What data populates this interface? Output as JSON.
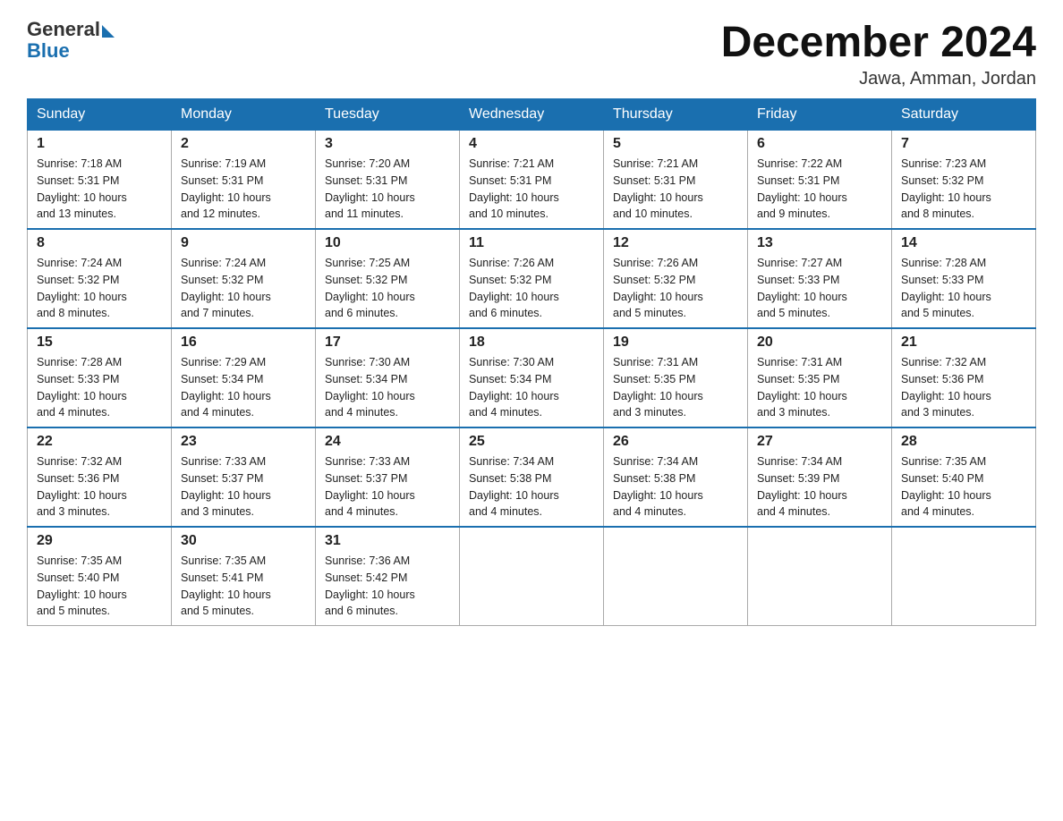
{
  "logo": {
    "general": "General",
    "blue": "Blue"
  },
  "title": "December 2024",
  "location": "Jawa, Amman, Jordan",
  "days_header": [
    "Sunday",
    "Monday",
    "Tuesday",
    "Wednesday",
    "Thursday",
    "Friday",
    "Saturday"
  ],
  "weeks": [
    [
      {
        "day": "1",
        "sunrise": "7:18 AM",
        "sunset": "5:31 PM",
        "daylight": "10 hours and 13 minutes."
      },
      {
        "day": "2",
        "sunrise": "7:19 AM",
        "sunset": "5:31 PM",
        "daylight": "10 hours and 12 minutes."
      },
      {
        "day": "3",
        "sunrise": "7:20 AM",
        "sunset": "5:31 PM",
        "daylight": "10 hours and 11 minutes."
      },
      {
        "day": "4",
        "sunrise": "7:21 AM",
        "sunset": "5:31 PM",
        "daylight": "10 hours and 10 minutes."
      },
      {
        "day": "5",
        "sunrise": "7:21 AM",
        "sunset": "5:31 PM",
        "daylight": "10 hours and 10 minutes."
      },
      {
        "day": "6",
        "sunrise": "7:22 AM",
        "sunset": "5:31 PM",
        "daylight": "10 hours and 9 minutes."
      },
      {
        "day": "7",
        "sunrise": "7:23 AM",
        "sunset": "5:32 PM",
        "daylight": "10 hours and 8 minutes."
      }
    ],
    [
      {
        "day": "8",
        "sunrise": "7:24 AM",
        "sunset": "5:32 PM",
        "daylight": "10 hours and 8 minutes."
      },
      {
        "day": "9",
        "sunrise": "7:24 AM",
        "sunset": "5:32 PM",
        "daylight": "10 hours and 7 minutes."
      },
      {
        "day": "10",
        "sunrise": "7:25 AM",
        "sunset": "5:32 PM",
        "daylight": "10 hours and 6 minutes."
      },
      {
        "day": "11",
        "sunrise": "7:26 AM",
        "sunset": "5:32 PM",
        "daylight": "10 hours and 6 minutes."
      },
      {
        "day": "12",
        "sunrise": "7:26 AM",
        "sunset": "5:32 PM",
        "daylight": "10 hours and 5 minutes."
      },
      {
        "day": "13",
        "sunrise": "7:27 AM",
        "sunset": "5:33 PM",
        "daylight": "10 hours and 5 minutes."
      },
      {
        "day": "14",
        "sunrise": "7:28 AM",
        "sunset": "5:33 PM",
        "daylight": "10 hours and 5 minutes."
      }
    ],
    [
      {
        "day": "15",
        "sunrise": "7:28 AM",
        "sunset": "5:33 PM",
        "daylight": "10 hours and 4 minutes."
      },
      {
        "day": "16",
        "sunrise": "7:29 AM",
        "sunset": "5:34 PM",
        "daylight": "10 hours and 4 minutes."
      },
      {
        "day": "17",
        "sunrise": "7:30 AM",
        "sunset": "5:34 PM",
        "daylight": "10 hours and 4 minutes."
      },
      {
        "day": "18",
        "sunrise": "7:30 AM",
        "sunset": "5:34 PM",
        "daylight": "10 hours and 4 minutes."
      },
      {
        "day": "19",
        "sunrise": "7:31 AM",
        "sunset": "5:35 PM",
        "daylight": "10 hours and 3 minutes."
      },
      {
        "day": "20",
        "sunrise": "7:31 AM",
        "sunset": "5:35 PM",
        "daylight": "10 hours and 3 minutes."
      },
      {
        "day": "21",
        "sunrise": "7:32 AM",
        "sunset": "5:36 PM",
        "daylight": "10 hours and 3 minutes."
      }
    ],
    [
      {
        "day": "22",
        "sunrise": "7:32 AM",
        "sunset": "5:36 PM",
        "daylight": "10 hours and 3 minutes."
      },
      {
        "day": "23",
        "sunrise": "7:33 AM",
        "sunset": "5:37 PM",
        "daylight": "10 hours and 3 minutes."
      },
      {
        "day": "24",
        "sunrise": "7:33 AM",
        "sunset": "5:37 PM",
        "daylight": "10 hours and 4 minutes."
      },
      {
        "day": "25",
        "sunrise": "7:34 AM",
        "sunset": "5:38 PM",
        "daylight": "10 hours and 4 minutes."
      },
      {
        "day": "26",
        "sunrise": "7:34 AM",
        "sunset": "5:38 PM",
        "daylight": "10 hours and 4 minutes."
      },
      {
        "day": "27",
        "sunrise": "7:34 AM",
        "sunset": "5:39 PM",
        "daylight": "10 hours and 4 minutes."
      },
      {
        "day": "28",
        "sunrise": "7:35 AM",
        "sunset": "5:40 PM",
        "daylight": "10 hours and 4 minutes."
      }
    ],
    [
      {
        "day": "29",
        "sunrise": "7:35 AM",
        "sunset": "5:40 PM",
        "daylight": "10 hours and 5 minutes."
      },
      {
        "day": "30",
        "sunrise": "7:35 AM",
        "sunset": "5:41 PM",
        "daylight": "10 hours and 5 minutes."
      },
      {
        "day": "31",
        "sunrise": "7:36 AM",
        "sunset": "5:42 PM",
        "daylight": "10 hours and 6 minutes."
      },
      null,
      null,
      null,
      null
    ]
  ],
  "labels": {
    "sunrise": "Sunrise:",
    "sunset": "Sunset:",
    "daylight": "Daylight:"
  }
}
